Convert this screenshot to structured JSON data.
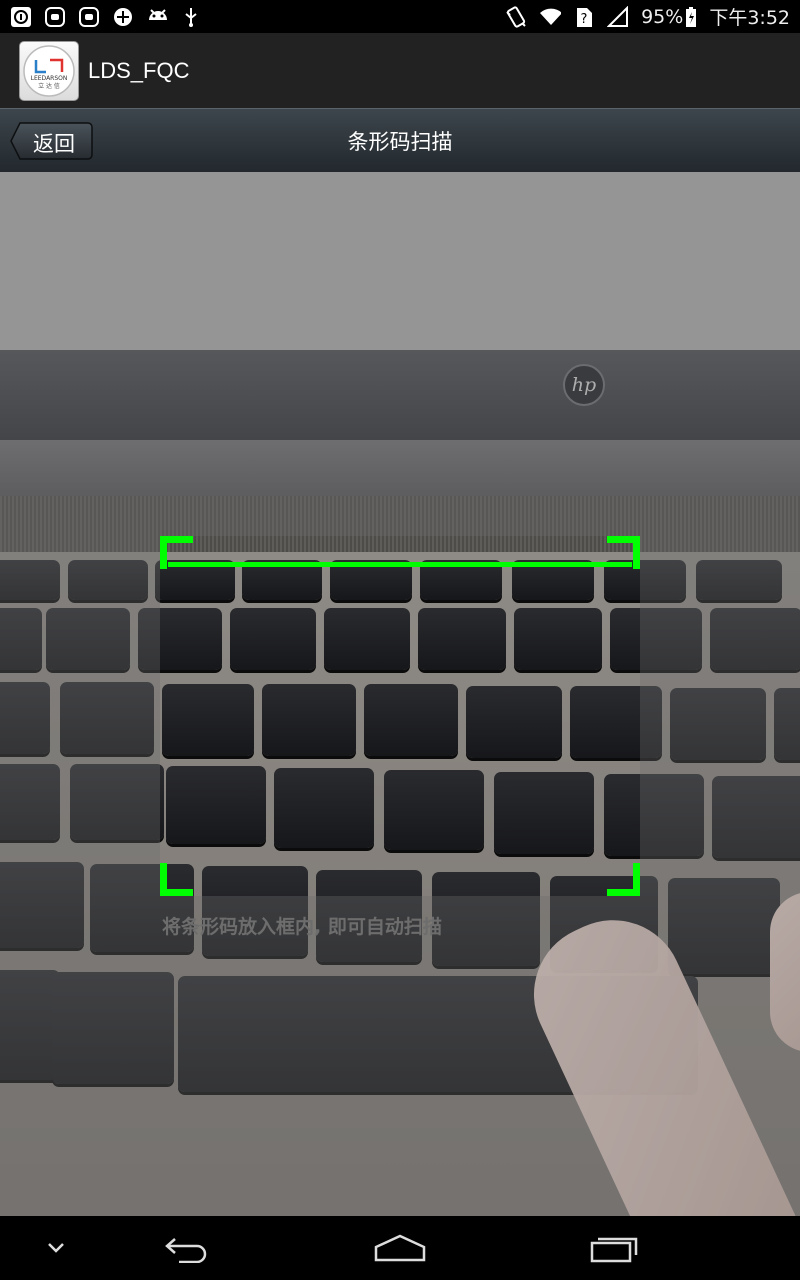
{
  "status_bar": {
    "battery": "95%",
    "time": "下午3:52",
    "left_icons": [
      "info-icon",
      "notification-app-icon",
      "notification-app-icon",
      "sync-icon",
      "android-icon",
      "usb-icon"
    ],
    "right_icons": [
      "vibrate-icon",
      "wifi-icon",
      "sim-unknown-icon",
      "signal-icon",
      "battery-charging-icon"
    ]
  },
  "app_bar": {
    "title": "LDS_FQC",
    "logo_text": "LEEDARSON",
    "logo_cn": "立 达 信"
  },
  "title_bar": {
    "back_label": "返回",
    "title": "条形码扫描"
  },
  "scanner": {
    "hint": "将条形码放入框内, 即可自动扫描",
    "frame_color": "#00ff00"
  },
  "nav_bar": {
    "icons": [
      "chevron-down-icon",
      "back-icon",
      "home-icon",
      "recent-apps-icon"
    ]
  }
}
